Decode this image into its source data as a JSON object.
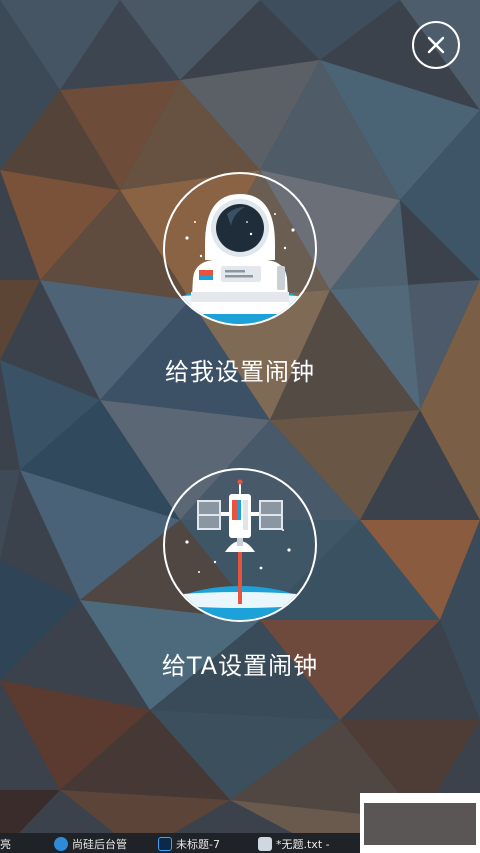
{
  "close_button": {
    "icon": "close-icon"
  },
  "options": {
    "me": {
      "label": "给我设置闹钟",
      "icon": "astronaut-icon"
    },
    "ta": {
      "label": "给TA设置闹钟",
      "icon": "satellite-icon"
    }
  },
  "taskbar": {
    "items": [
      {
        "label": "亮"
      },
      {
        "label": "尚硅后台管"
      },
      {
        "label": "未标题-7"
      },
      {
        "label": "*无题.txt -"
      }
    ]
  },
  "colors": {
    "earth_blue": "#1da1d9",
    "accent_red": "#e8533f",
    "white": "#ffffff"
  }
}
